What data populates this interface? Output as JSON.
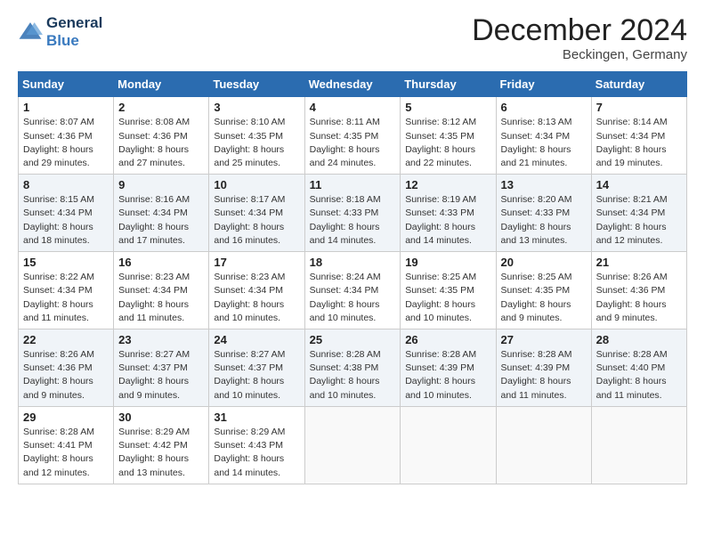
{
  "logo": {
    "line1": "General",
    "line2": "Blue"
  },
  "title": "December 2024",
  "subtitle": "Beckingen, Germany",
  "days_header": [
    "Sunday",
    "Monday",
    "Tuesday",
    "Wednesday",
    "Thursday",
    "Friday",
    "Saturday"
  ],
  "weeks": [
    [
      {
        "num": "1",
        "rise": "8:07 AM",
        "set": "4:36 PM",
        "daylight": "8 hours and 29 minutes."
      },
      {
        "num": "2",
        "rise": "8:08 AM",
        "set": "4:36 PM",
        "daylight": "8 hours and 27 minutes."
      },
      {
        "num": "3",
        "rise": "8:10 AM",
        "set": "4:35 PM",
        "daylight": "8 hours and 25 minutes."
      },
      {
        "num": "4",
        "rise": "8:11 AM",
        "set": "4:35 PM",
        "daylight": "8 hours and 24 minutes."
      },
      {
        "num": "5",
        "rise": "8:12 AM",
        "set": "4:35 PM",
        "daylight": "8 hours and 22 minutes."
      },
      {
        "num": "6",
        "rise": "8:13 AM",
        "set": "4:34 PM",
        "daylight": "8 hours and 21 minutes."
      },
      {
        "num": "7",
        "rise": "8:14 AM",
        "set": "4:34 PM",
        "daylight": "8 hours and 19 minutes."
      }
    ],
    [
      {
        "num": "8",
        "rise": "8:15 AM",
        "set": "4:34 PM",
        "daylight": "8 hours and 18 minutes."
      },
      {
        "num": "9",
        "rise": "8:16 AM",
        "set": "4:34 PM",
        "daylight": "8 hours and 17 minutes."
      },
      {
        "num": "10",
        "rise": "8:17 AM",
        "set": "4:34 PM",
        "daylight": "8 hours and 16 minutes."
      },
      {
        "num": "11",
        "rise": "8:18 AM",
        "set": "4:33 PM",
        "daylight": "8 hours and 14 minutes."
      },
      {
        "num": "12",
        "rise": "8:19 AM",
        "set": "4:33 PM",
        "daylight": "8 hours and 14 minutes."
      },
      {
        "num": "13",
        "rise": "8:20 AM",
        "set": "4:33 PM",
        "daylight": "8 hours and 13 minutes."
      },
      {
        "num": "14",
        "rise": "8:21 AM",
        "set": "4:34 PM",
        "daylight": "8 hours and 12 minutes."
      }
    ],
    [
      {
        "num": "15",
        "rise": "8:22 AM",
        "set": "4:34 PM",
        "daylight": "8 hours and 11 minutes."
      },
      {
        "num": "16",
        "rise": "8:23 AM",
        "set": "4:34 PM",
        "daylight": "8 hours and 11 minutes."
      },
      {
        "num": "17",
        "rise": "8:23 AM",
        "set": "4:34 PM",
        "daylight": "8 hours and 10 minutes."
      },
      {
        "num": "18",
        "rise": "8:24 AM",
        "set": "4:34 PM",
        "daylight": "8 hours and 10 minutes."
      },
      {
        "num": "19",
        "rise": "8:25 AM",
        "set": "4:35 PM",
        "daylight": "8 hours and 10 minutes."
      },
      {
        "num": "20",
        "rise": "8:25 AM",
        "set": "4:35 PM",
        "daylight": "8 hours and 9 minutes."
      },
      {
        "num": "21",
        "rise": "8:26 AM",
        "set": "4:36 PM",
        "daylight": "8 hours and 9 minutes."
      }
    ],
    [
      {
        "num": "22",
        "rise": "8:26 AM",
        "set": "4:36 PM",
        "daylight": "8 hours and 9 minutes."
      },
      {
        "num": "23",
        "rise": "8:27 AM",
        "set": "4:37 PM",
        "daylight": "8 hours and 9 minutes."
      },
      {
        "num": "24",
        "rise": "8:27 AM",
        "set": "4:37 PM",
        "daylight": "8 hours and 10 minutes."
      },
      {
        "num": "25",
        "rise": "8:28 AM",
        "set": "4:38 PM",
        "daylight": "8 hours and 10 minutes."
      },
      {
        "num": "26",
        "rise": "8:28 AM",
        "set": "4:39 PM",
        "daylight": "8 hours and 10 minutes."
      },
      {
        "num": "27",
        "rise": "8:28 AM",
        "set": "4:39 PM",
        "daylight": "8 hours and 11 minutes."
      },
      {
        "num": "28",
        "rise": "8:28 AM",
        "set": "4:40 PM",
        "daylight": "8 hours and 11 minutes."
      }
    ],
    [
      {
        "num": "29",
        "rise": "8:28 AM",
        "set": "4:41 PM",
        "daylight": "8 hours and 12 minutes."
      },
      {
        "num": "30",
        "rise": "8:29 AM",
        "set": "4:42 PM",
        "daylight": "8 hours and 13 minutes."
      },
      {
        "num": "31",
        "rise": "8:29 AM",
        "set": "4:43 PM",
        "daylight": "8 hours and 14 minutes."
      },
      null,
      null,
      null,
      null
    ]
  ],
  "labels": {
    "sunrise": "Sunrise:",
    "sunset": "Sunset:",
    "daylight": "Daylight:"
  }
}
